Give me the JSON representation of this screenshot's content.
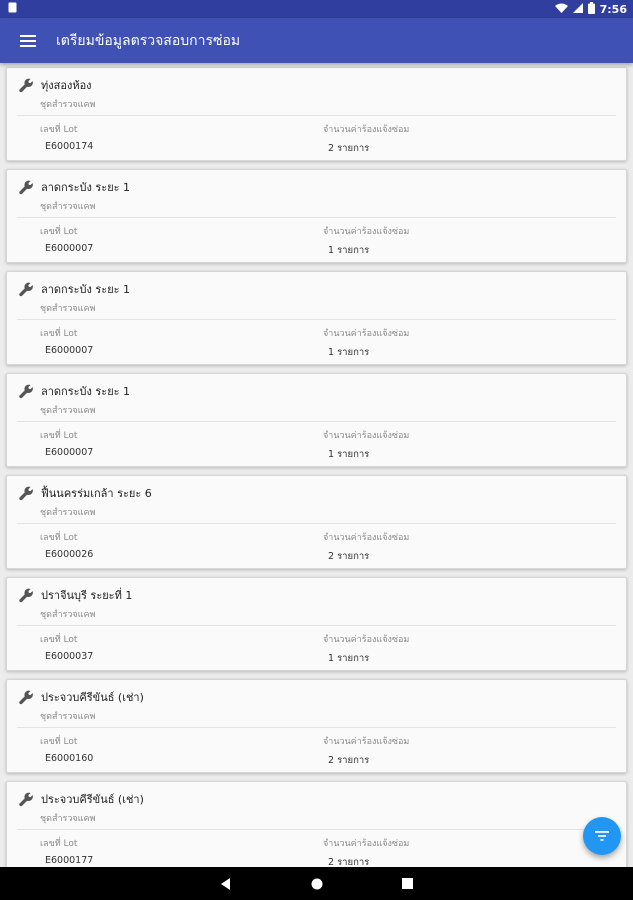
{
  "status_bar": {
    "time": "7:56",
    "icons": [
      "notification-icon",
      "wifi-icon",
      "signal-icon",
      "battery-icon"
    ]
  },
  "toolbar": {
    "title": "เตรียมข้อมูลตรวจสอบการซ่อม",
    "menu_icon": "hamburger-menu-icon"
  },
  "cards": [
    {
      "title": "ทุ่งสองห้อง",
      "subtitle": "ชุดสำรวจแคพ",
      "lot_label": "เลขที่ Lot",
      "lot": "E6000174",
      "count_label": "จำนวนค่าร้องแจ้งซ่อม",
      "count": "2 รายการ"
    },
    {
      "title": "ลาดกระบัง ระยะ 1",
      "subtitle": "ชุดสำรวจแคพ",
      "lot_label": "เลขที่ Lot",
      "lot": "E6000007",
      "count_label": "จำนวนค่าร้องแจ้งซ่อม",
      "count": "1 รายการ"
    },
    {
      "title": "ลาดกระบัง ระยะ 1",
      "subtitle": "ชุดสำรวจแคพ",
      "lot_label": "เลขที่ Lot",
      "lot": "E6000007",
      "count_label": "จำนวนค่าร้องแจ้งซ่อม",
      "count": "1 รายการ"
    },
    {
      "title": "ลาดกระบัง ระยะ 1",
      "subtitle": "ชุดสำรวจแคพ",
      "lot_label": "เลขที่ Lot",
      "lot": "E6000007",
      "count_label": "จำนวนค่าร้องแจ้งซ่อม",
      "count": "1 รายการ"
    },
    {
      "title": "ฟื้นนครร่มเกล้า ระยะ 6",
      "subtitle": "ชุดสำรวจแคพ",
      "lot_label": "เลขที่ Lot",
      "lot": "E6000026",
      "count_label": "จำนวนค่าร้องแจ้งซ่อม",
      "count": "2 รายการ"
    },
    {
      "title": "ปราจีนบุรี ระยะที่ 1",
      "subtitle": "ชุดสำรวจแคพ",
      "lot_label": "เลขที่ Lot",
      "lot": "E6000037",
      "count_label": "จำนวนค่าร้องแจ้งซ่อม",
      "count": "1 รายการ"
    },
    {
      "title": "ประจวบคีรีขันธ์ (เช่า)",
      "subtitle": "ชุดสำรวจแคพ",
      "lot_label": "เลขที่ Lot",
      "lot": "E6000160",
      "count_label": "จำนวนค่าร้องแจ้งซ่อม",
      "count": "2 รายการ"
    },
    {
      "title": "ประจวบคีรีขันธ์ (เช่า)",
      "subtitle": "ชุดสำรวจแคพ",
      "lot_label": "เลขที่ Lot",
      "lot": "E6000177",
      "count_label": "จำนวนค่าร้องแจ้งซ่อม",
      "count": "2 รายการ"
    }
  ],
  "fab": {
    "icon": "filter-icon",
    "color": "#2196f3"
  },
  "nav_bar": {
    "icons": [
      "back-icon",
      "home-icon",
      "recents-icon"
    ]
  },
  "colors": {
    "primary": "#3f51b5",
    "primary_dark": "#303f9f",
    "accent": "#2196f3"
  }
}
